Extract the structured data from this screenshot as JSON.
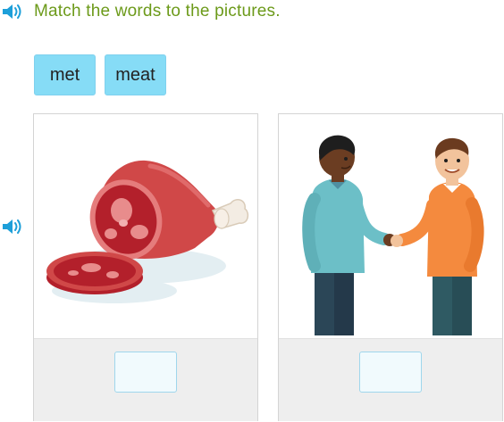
{
  "instruction": {
    "text": "Match the words to the pictures."
  },
  "tiles": [
    {
      "label": "met"
    },
    {
      "label": "meat"
    }
  ],
  "cards": [
    {
      "picture": "meat-ham-icon",
      "drop_value": ""
    },
    {
      "picture": "handshake-people-icon",
      "drop_value": ""
    }
  ],
  "icons": {
    "speaker": "speaker-icon"
  },
  "colors": {
    "instruction": "#6c9a1a",
    "tile_bg": "#86dcf6",
    "speaker": "#1d9fd9"
  }
}
